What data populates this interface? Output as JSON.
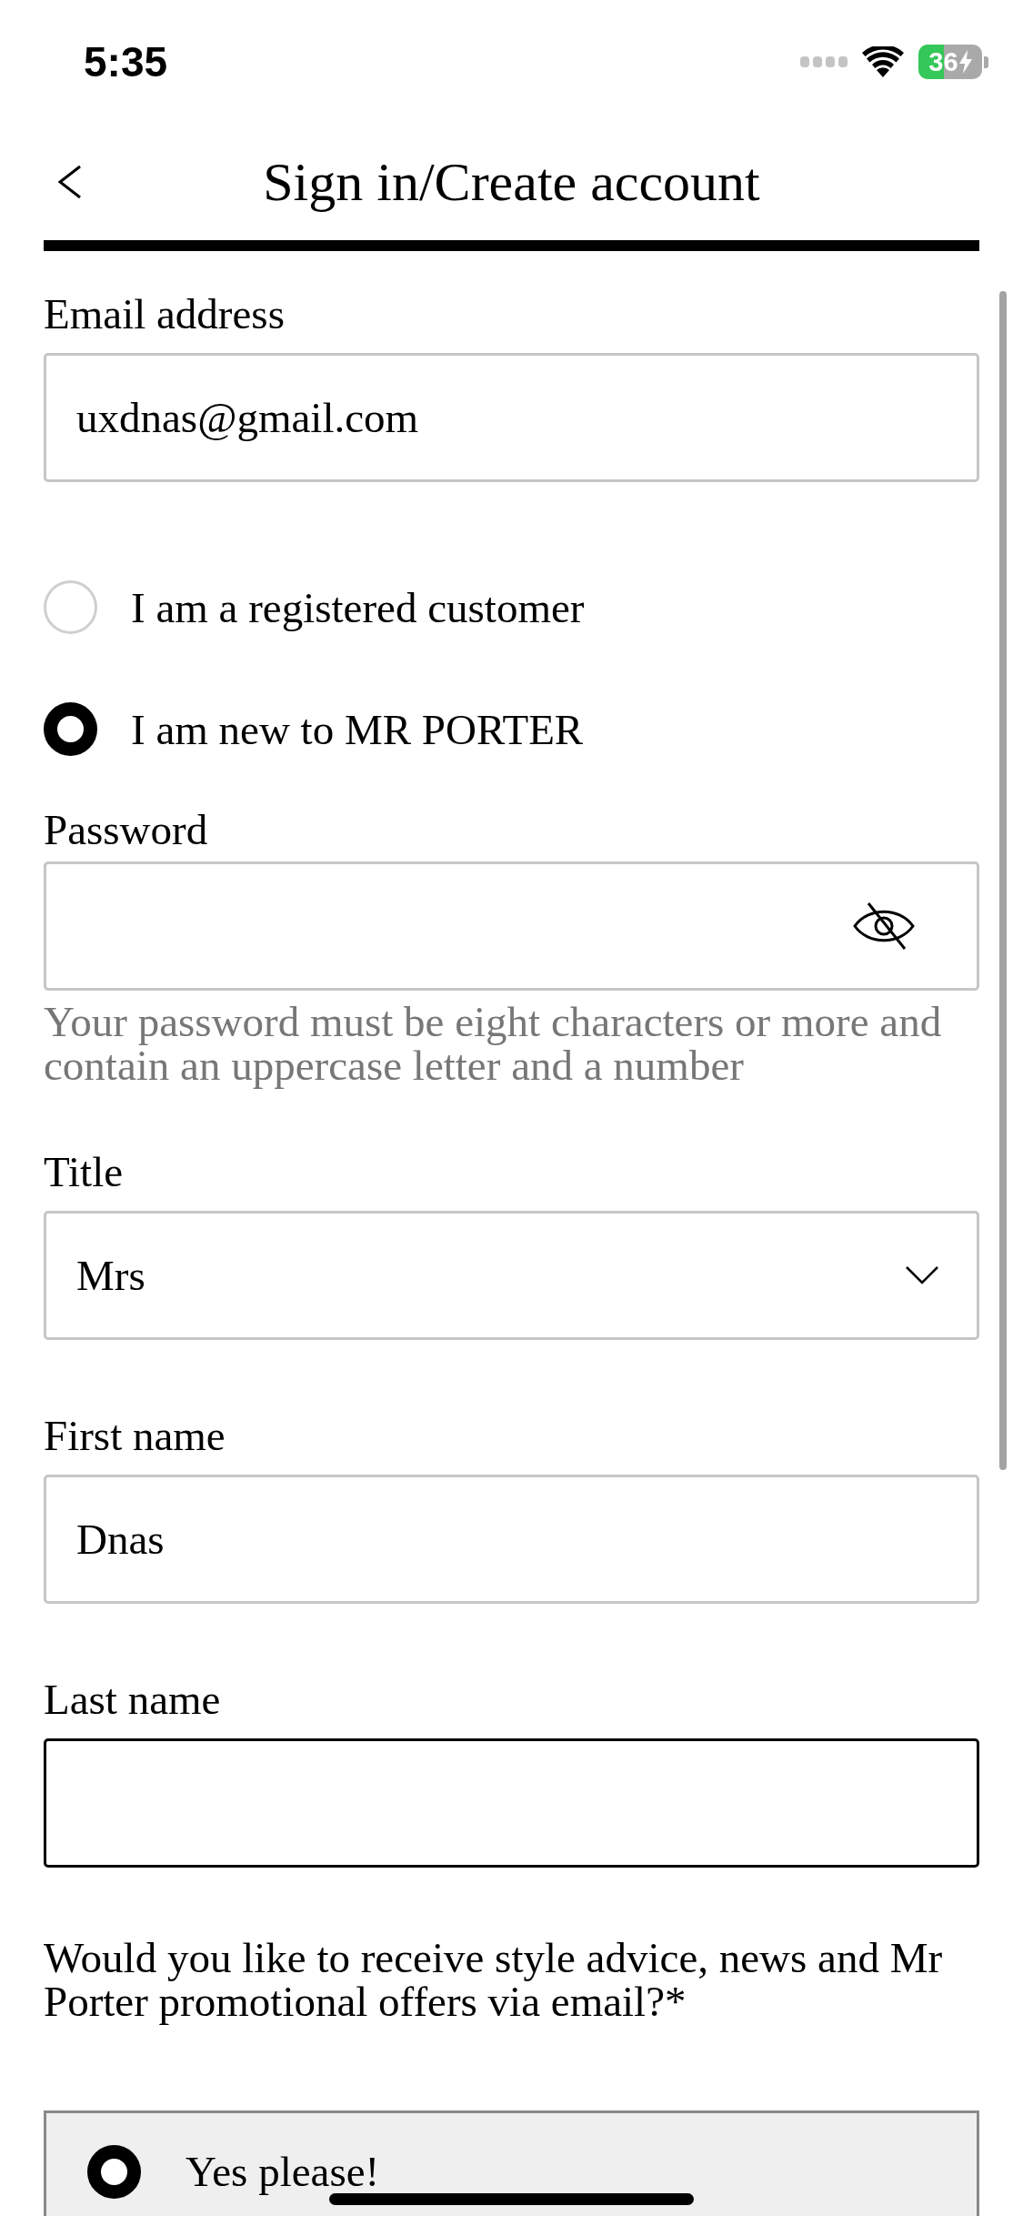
{
  "status_bar": {
    "time": "5:35",
    "battery": "36"
  },
  "header": {
    "title": "Sign in/Create account"
  },
  "form": {
    "email": {
      "label": "Email address",
      "value": "uxdnas@gmail.com"
    },
    "account_type": [
      {
        "label": "I am a registered customer",
        "selected": false
      },
      {
        "label": "I am new to MR PORTER",
        "selected": true
      }
    ],
    "password": {
      "label": "Password",
      "hint": "Your password must be eight characters or more and contain an uppercase letter and a number"
    },
    "title": {
      "label": "Title",
      "value": "Mrs"
    },
    "first_name": {
      "label": "First name",
      "value": "Dnas"
    },
    "last_name": {
      "label": "Last name",
      "focused": true
    },
    "marketing": {
      "question": "Would you like to receive style advice, news and Mr Porter promotional offers via email?*",
      "options": [
        {
          "label": "Yes please!",
          "selected": true
        }
      ]
    }
  }
}
